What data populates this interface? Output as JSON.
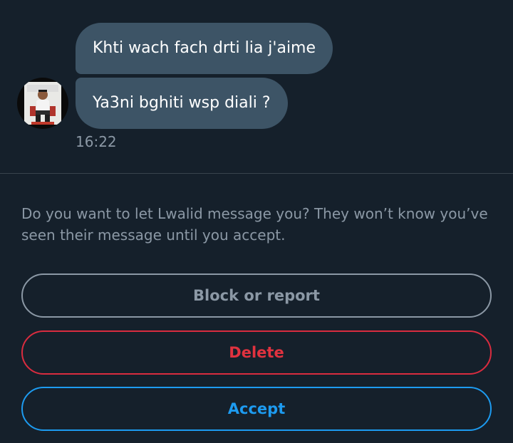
{
  "conversation": {
    "messages": [
      {
        "text": "Khti wach fach drti lia j'aime"
      },
      {
        "text": "Ya3ni bghiti wsp diali ?"
      }
    ],
    "timestamp": "16:22",
    "sender_avatar_icon": "profile-photo"
  },
  "request": {
    "prompt": "Do you want to let Lwalid message you? They won’t know you’ve seen their message until you accept.",
    "block_label": "Block or report",
    "delete_label": "Delete",
    "accept_label": "Accept"
  },
  "colors": {
    "background": "#15202b",
    "bubble": "#3d5466",
    "secondary_text": "#8b98a5",
    "delete": "#e0323f",
    "accept": "#1d9bf0"
  }
}
